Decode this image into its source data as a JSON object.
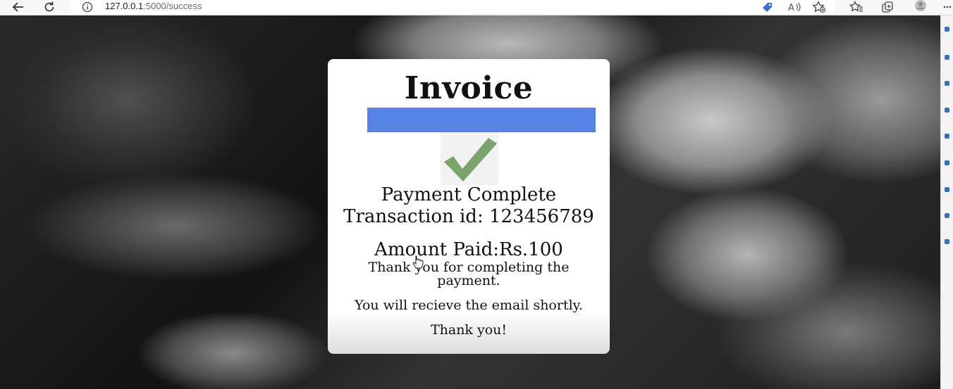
{
  "browser": {
    "url_host": "127.0.0.1",
    "url_path": ":5000/success",
    "back_icon": "arrow-left-icon",
    "reload_icon": "reload-icon",
    "info_icon": "info-icon"
  },
  "invoice": {
    "title": "Invoice",
    "accent_color": "#5583e6",
    "check_icon": "checkmark-icon",
    "status": "Payment Complete",
    "transaction": "Transaction id: 123456789",
    "amount": "Amount Paid:Rs.100",
    "thanks_message": "Thank you for completing the payment.",
    "email_note": "You will recieve the email shortly.",
    "closing": "Thank you!"
  }
}
